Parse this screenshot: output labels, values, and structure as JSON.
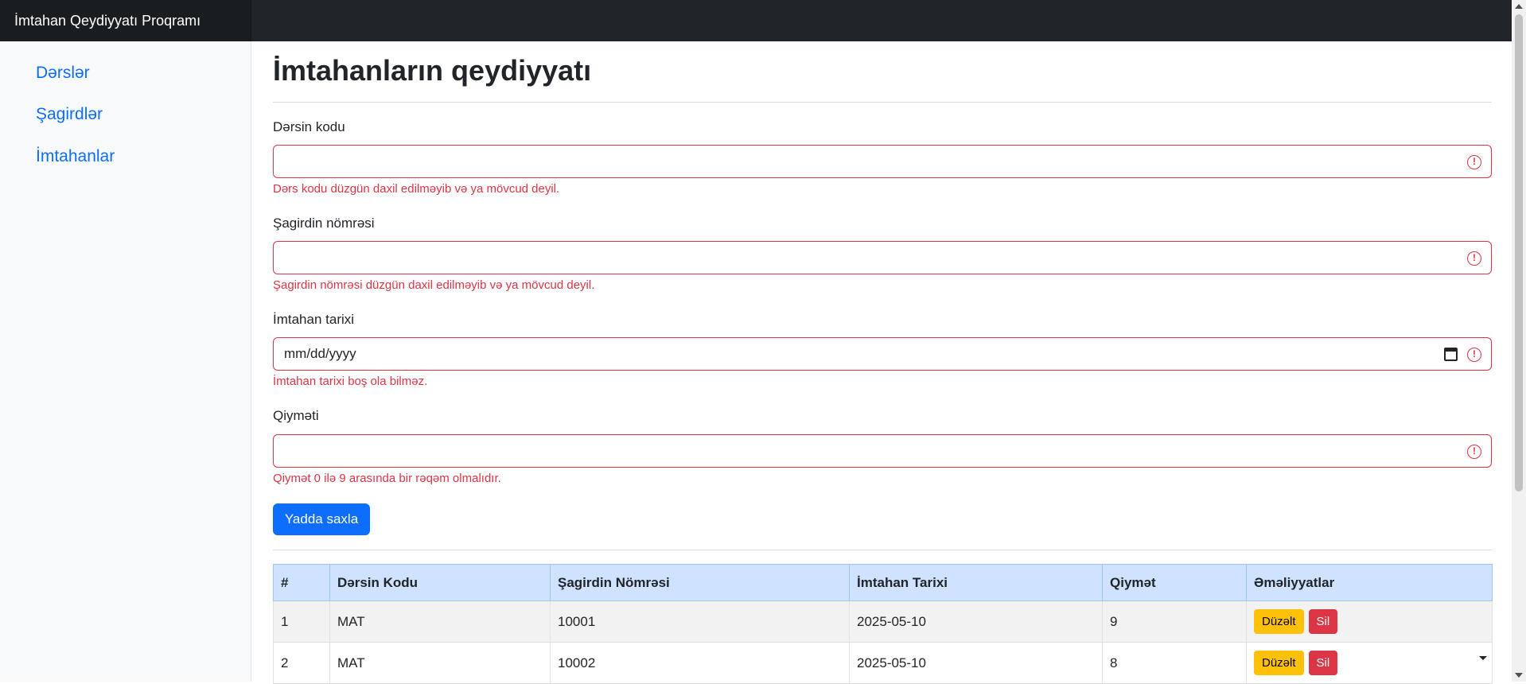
{
  "app": {
    "brand": "İmtahan Qeydiyyatı Proqramı"
  },
  "sidebar": {
    "items": [
      {
        "label": "Dərslər"
      },
      {
        "label": "Şagirdlər"
      },
      {
        "label": "İmtahanlar"
      }
    ]
  },
  "page": {
    "title": "İmtahanların qeydiyyatı"
  },
  "form": {
    "lesson_code": {
      "label": "Dərsin kodu",
      "value": "",
      "error": "Dərs kodu düzgün daxil edilməyib və ya mövcud deyil."
    },
    "student_number": {
      "label": "Şagirdin nömrəsi",
      "value": "",
      "error": "Şagirdin nömrəsi düzgün daxil edilməyib və ya mövcud deyil."
    },
    "exam_date": {
      "label": "İmtahan tarixi",
      "placeholder": "mm/dd/yyyy",
      "error": "İmtahan tarixi boş ola bilməz."
    },
    "grade": {
      "label": "Qiyməti",
      "value": "",
      "error": "Qiymət 0 ilə 9 arasında bir rəqəm olmalıdır."
    },
    "save_label": "Yadda saxla"
  },
  "table": {
    "headers": [
      "#",
      "Dərsin Kodu",
      "Şagirdin Nömrəsi",
      "İmtahan Tarixi",
      "Qiymət",
      "Əməliyyatlar"
    ],
    "rows": [
      {
        "n": "1",
        "code": "MAT",
        "student": "10001",
        "date": "2025-05-10",
        "grade": "9"
      },
      {
        "n": "2",
        "code": "MAT",
        "student": "10002",
        "date": "2025-05-10",
        "grade": "8"
      }
    ],
    "edit_label": "Düzəlt",
    "delete_label": "Sil"
  },
  "colors": {
    "primary": "#0d6efd",
    "danger": "#dc3545",
    "warning": "#ffc107",
    "header_bg": "#212529",
    "table_head": "#cfe2ff"
  },
  "icons": {
    "invalid": "exclamation-circle-icon",
    "calendar": "calendar-icon"
  }
}
